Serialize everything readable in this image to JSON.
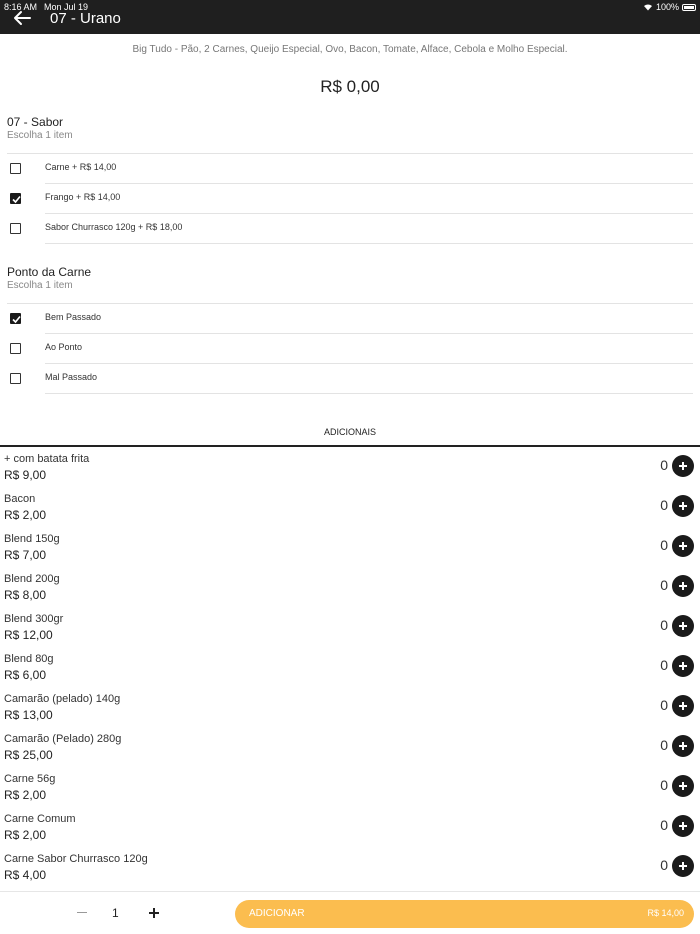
{
  "status": {
    "time": "8:16 AM",
    "date": "Mon Jul 19",
    "battery": "100%"
  },
  "header": {
    "title": "07 - Urano"
  },
  "description": "Big Tudo - Pão, 2 Carnes, Queijo Especial, Ovo, Bacon, Tomate, Alface, Cebola e Molho Especial.",
  "total_price": "R$ 0,00",
  "groups": [
    {
      "title": "07 - Sabor",
      "subtitle": "Escolha 1 item",
      "options": [
        {
          "label": "Carne + R$ 14,00",
          "checked": false
        },
        {
          "label": "Frango + R$ 14,00",
          "checked": true
        },
        {
          "label": "Sabor Churrasco 120g + R$ 18,00",
          "checked": false
        }
      ]
    },
    {
      "title": "Ponto da Carne",
      "subtitle": "Escolha 1 item",
      "options": [
        {
          "label": "Bem Passado",
          "checked": true
        },
        {
          "label": "Ao Ponto",
          "checked": false
        },
        {
          "label": "Mal Passado",
          "checked": false
        }
      ]
    }
  ],
  "adicionais": {
    "title": "ADICIONAIS",
    "items": [
      {
        "name": "+ com batata frita",
        "price": "R$ 9,00",
        "qty": "0"
      },
      {
        "name": "Bacon",
        "price": "R$ 2,00",
        "qty": "0"
      },
      {
        "name": "Blend 150g",
        "price": "R$ 7,00",
        "qty": "0"
      },
      {
        "name": "Blend 200g",
        "price": "R$ 8,00",
        "qty": "0"
      },
      {
        "name": "Blend 300gr",
        "price": "R$ 12,00",
        "qty": "0"
      },
      {
        "name": "Blend 80g",
        "price": "R$ 6,00",
        "qty": "0"
      },
      {
        "name": "Camarão (pelado) 140g",
        "price": "R$ 13,00",
        "qty": "0"
      },
      {
        "name": "Camarão (Pelado) 280g",
        "price": "R$ 25,00",
        "qty": "0"
      },
      {
        "name": "Carne 56g",
        "price": "R$ 2,00",
        "qty": "0"
      },
      {
        "name": "Carne Comum",
        "price": "R$ 2,00",
        "qty": "0"
      },
      {
        "name": "Carne Sabor Churrasco 120g",
        "price": "R$ 4,00",
        "qty": "0"
      }
    ]
  },
  "footer": {
    "quantity": "1",
    "add_label": "ADICIONAR",
    "add_price": "R$ 14,00"
  },
  "colors": {
    "header_bg": "#1f1f1f",
    "accent": "#fbbd4f",
    "checkbox_checked": "#1a1a1a"
  }
}
